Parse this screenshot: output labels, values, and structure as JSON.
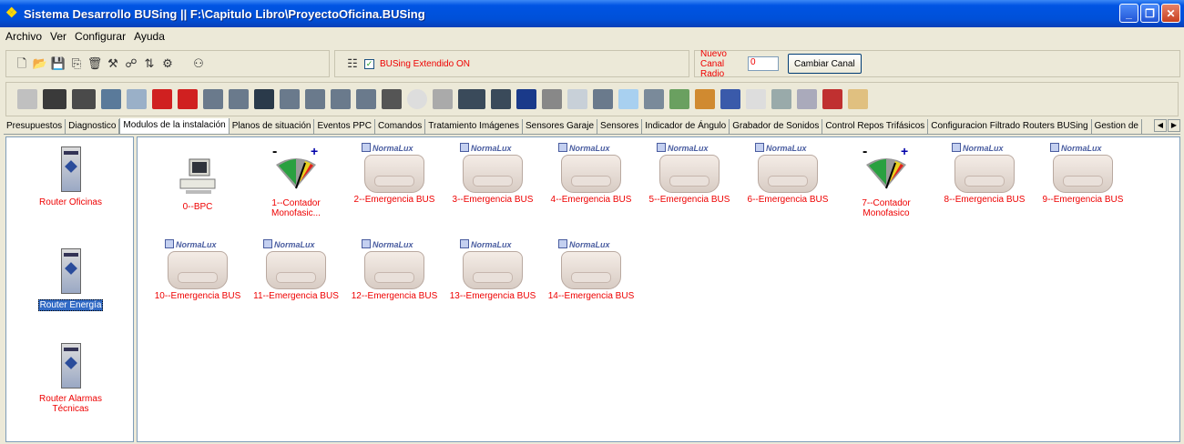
{
  "window": {
    "title": "Sistema Desarrollo BUSing || F:\\Capitulo Libro\\ProyectoOficina.BUSing"
  },
  "menu": [
    "Archivo",
    "Ver",
    "Configurar",
    "Ayuda"
  ],
  "toolbar": {
    "busing_extended": {
      "label": "BUSing Extendido ON",
      "checked": true
    },
    "channel": {
      "label": "Nuevo Canal Radio",
      "value": "0",
      "button": "Cambiar Canal"
    }
  },
  "tabs": [
    "Presupuestos",
    "Diagnostico",
    "Modulos de la instalación",
    "Planos de situación",
    "Eventos PPC",
    "Comandos",
    "Tratamiento Imágenes",
    "Sensores Garaje",
    "Sensores",
    "Indicador de Ángulo",
    "Grabador de Sonidos",
    "Control Repos Trifásicos",
    "Configuracion Filtrado Routers BUSing",
    "Gestion de"
  ],
  "active_tab": "Modulos de la instalación",
  "routers": [
    {
      "label": "Router Oficinas",
      "selected": false
    },
    {
      "label": "Router Energía",
      "selected": true
    },
    {
      "label": "Router Alarmas Técnicas",
      "selected": false
    }
  ],
  "brand": "NormaLux",
  "modules": [
    {
      "label": "0--BPC",
      "type": "pc"
    },
    {
      "label": "1--Contador Monofasic...",
      "type": "gauge"
    },
    {
      "label": "2--Emergencia BUS",
      "type": "lamp"
    },
    {
      "label": "3--Emergencia BUS",
      "type": "lamp"
    },
    {
      "label": "4--Emergencia BUS",
      "type": "lamp"
    },
    {
      "label": "5--Emergencia BUS",
      "type": "lamp"
    },
    {
      "label": "6--Emergencia BUS",
      "type": "lamp"
    },
    {
      "label": "7--Contador Monofasico",
      "type": "gauge"
    },
    {
      "label": "8--Emergencia BUS",
      "type": "lamp"
    },
    {
      "label": "9--Emergencia BUS",
      "type": "lamp"
    },
    {
      "label": "10--Emergencia BUS",
      "type": "lamp"
    },
    {
      "label": "11--Emergencia BUS",
      "type": "lamp"
    },
    {
      "label": "12--Emergencia BUS",
      "type": "lamp"
    },
    {
      "label": "13--Emergencia BUS",
      "type": "lamp"
    },
    {
      "label": "14--Emergencia BUS",
      "type": "lamp"
    }
  ]
}
